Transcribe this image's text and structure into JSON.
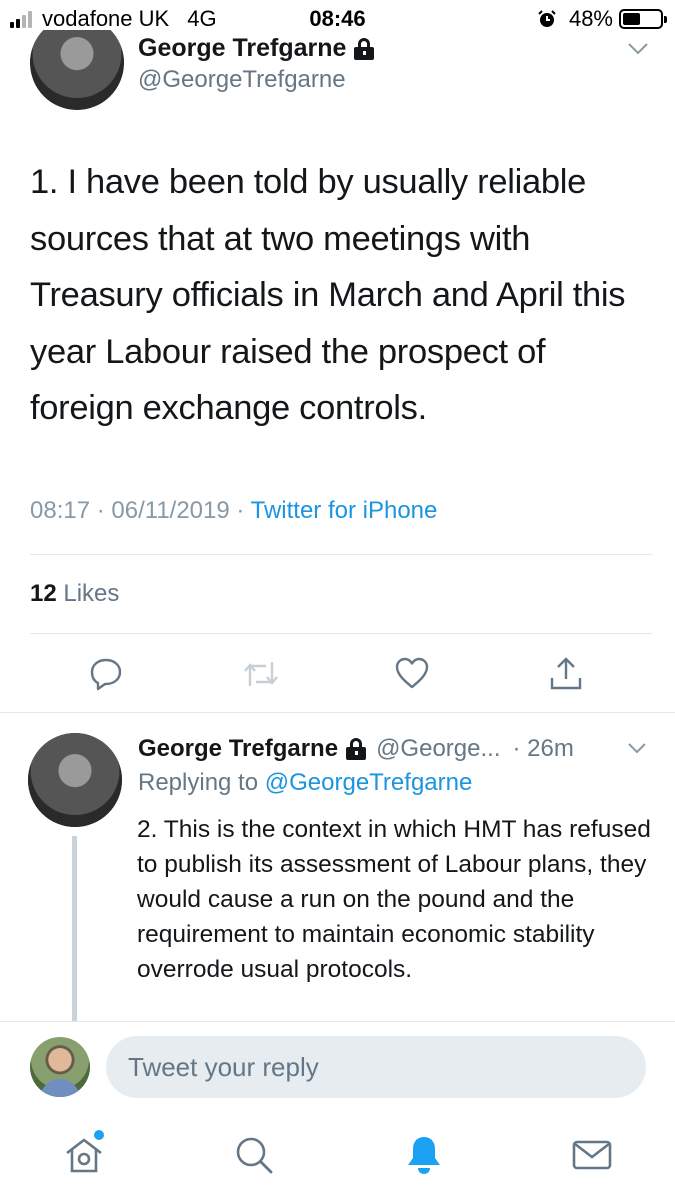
{
  "status_bar": {
    "carrier": "vodafone UK",
    "network": "4G",
    "time": "08:46",
    "battery_percent": "48%",
    "battery_level": 0.48,
    "signal_bars": 2,
    "signal_total": 4,
    "alarm_icon": "alarm-clock-icon"
  },
  "main_tweet": {
    "author_name": "George Trefgarne",
    "author_handle": "@GeorgeTrefgarne",
    "text": "1. I have been told by usually reliable sources that at two meetings with Treasury officials in March and April this year Labour raised the prospect of foreign exchange controls.",
    "timestamp": "08:17 · 06/11/2019 · ",
    "source": "Twitter for iPhone",
    "likes_count": "12",
    "likes_label": " Likes",
    "actions": [
      "reply-icon",
      "retweet-icon",
      "like-icon",
      "share-icon"
    ]
  },
  "reply_tweet": {
    "author_name": "George Trefgarne",
    "author_handle": "@George...",
    "time": "· 26m",
    "replying_prefix": "Replying to ",
    "replying_to": "@GeorgeTrefgarne",
    "text": "2. This is the context in which HMT has refused to publish its assessment of Labour plans, they would cause a run on the pound and the requirement to maintain economic stability overrode usual protocols."
  },
  "composer": {
    "placeholder": "Tweet your reply"
  },
  "tab_bar": {
    "tabs": [
      "home-icon",
      "search-icon",
      "notifications-icon",
      "messages-icon"
    ],
    "active_tab": "notifications-icon",
    "home_has_new_dot": true
  },
  "colors": {
    "accent": "#1da1f2",
    "link": "#1b95e0",
    "secondary_text": "#657786",
    "divider": "#e1e8ed"
  }
}
